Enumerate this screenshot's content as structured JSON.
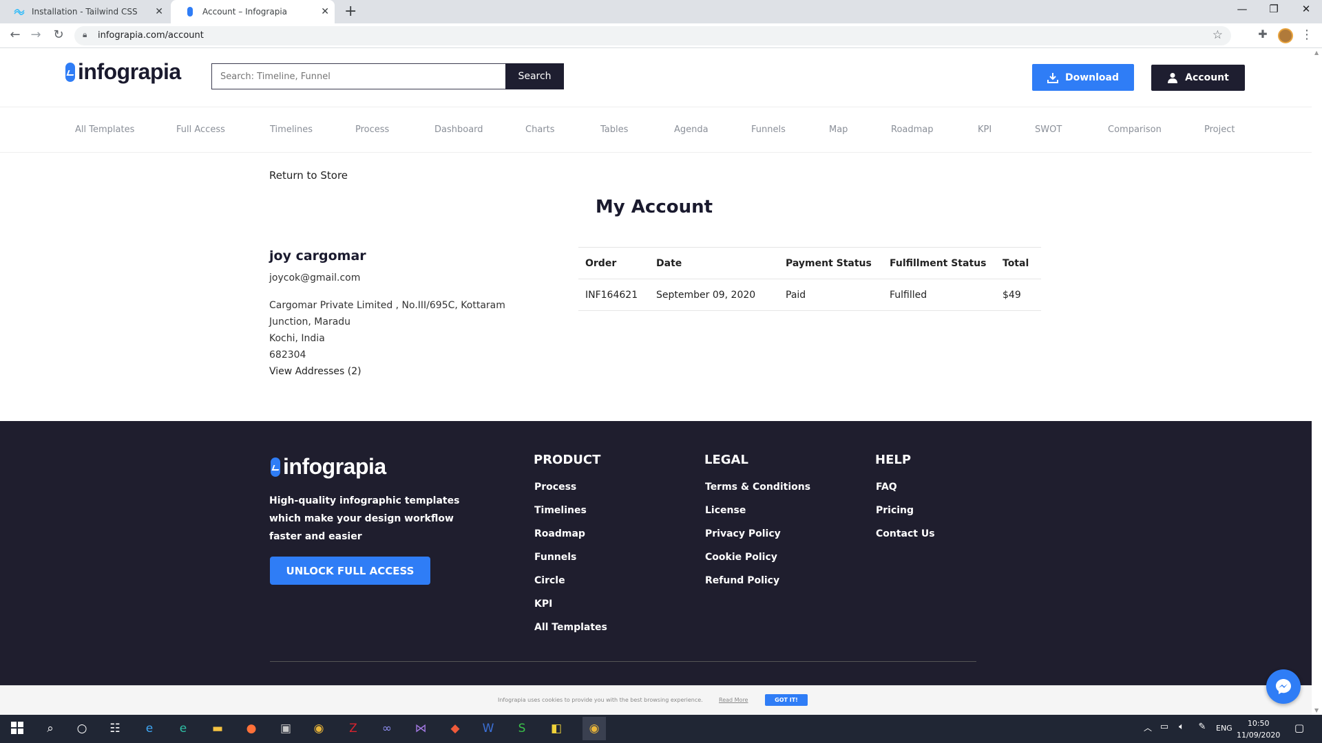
{
  "browser": {
    "tabs": [
      {
        "title": "Installation - Tailwind CSS"
      },
      {
        "title": "Account – Infograpia"
      }
    ],
    "url": "infograpia.com/account"
  },
  "header": {
    "logo": "infograpia",
    "search": {
      "placeholder": "Search: Timeline, Funnel",
      "button": "Search"
    },
    "download_label": "Download",
    "account_label": "Account"
  },
  "nav": [
    "All Templates",
    "Full Access",
    "Timelines",
    "Process",
    "Dashboard",
    "Charts",
    "Tables",
    "Agenda",
    "Funnels",
    "Map",
    "Roadmap",
    "KPI",
    "SWOT",
    "Comparison",
    "Project"
  ],
  "content": {
    "return_link": "Return to Store",
    "title": "My Account",
    "user": {
      "name": "joy cargomar",
      "email": "joycok@gmail.com",
      "address_lines": [
        "Cargomar Private Limited , No.III/695C, Kottaram",
        "Junction, Maradu",
        "Kochi, India",
        "682304"
      ],
      "view_addresses": "View Addresses (2)"
    },
    "orders": {
      "columns": [
        "Order",
        "Date",
        "Payment Status",
        "Fulfillment Status",
        "Total"
      ],
      "rows": [
        [
          "INF164621",
          "September 09, 2020",
          "Paid",
          "Fulfilled",
          "$49"
        ]
      ]
    }
  },
  "footer": {
    "logo": "infograpia",
    "tagline": "High-quality infographic templates which make your design workflow faster and easier",
    "unlock_label": "UNLOCK FULL ACCESS",
    "product": {
      "heading": "PRODUCT",
      "links": [
        "Process",
        "Timelines",
        "Roadmap",
        "Funnels",
        "Circle",
        "KPI",
        "All Templates"
      ]
    },
    "legal": {
      "heading": "LEGAL",
      "links": [
        "Terms & Conditions",
        "License",
        "Privacy Policy",
        "Cookie Policy",
        "Refund Policy"
      ]
    },
    "help": {
      "heading": "HELP",
      "links": [
        "FAQ",
        "Pricing",
        "Contact Us"
      ]
    }
  },
  "cookie": {
    "text": "Infograpia uses cookies to provide you with the best browsing experience.",
    "read_more": "Read More",
    "button": "GOT IT!"
  },
  "taskbar": {
    "lang": "ENG",
    "time": "10:50",
    "date": "11/09/2020"
  },
  "colors": {
    "brand_blue": "#2f7df6",
    "dark": "#1f1e2e",
    "nav_gray": "#8a8f98"
  }
}
